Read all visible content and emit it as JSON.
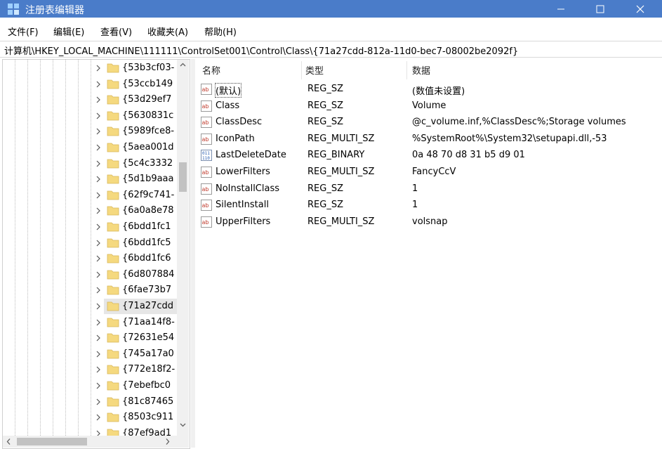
{
  "window": {
    "title": "注册表编辑器",
    "colors": {
      "titlebar": "#4a7cc9",
      "folder": "#f5d97f"
    }
  },
  "menu": [
    "文件(F)",
    "编辑(E)",
    "查看(V)",
    "收藏夹(A)",
    "帮助(H)"
  ],
  "address": "计算机\\HKEY_LOCAL_MACHINE\\111111\\ControlSet001\\Control\\Class\\{71a27cdd-812a-11d0-bec7-08002be2092f}",
  "tree": {
    "items": [
      "{53b3cf03-",
      "{53ccb149",
      "{53d29ef7",
      "{5630831c",
      "{5989fce8-",
      "{5aea001d",
      "{5c4c3332",
      "{5d1b9aaa",
      "{62f9c741-",
      "{6a0a8e78",
      "{6bdd1fc1",
      "{6bdd1fc5",
      "{6bdd1fc6",
      "{6d807884",
      "{6fae73b7",
      "{71a27cdd",
      "{71aa14f8-",
      "{72631e54",
      "{745a17a0",
      "{772e18f2-",
      "{7ebefbc0",
      "{81c87465",
      "{8503c911",
      "{87ef9ad1"
    ],
    "selected": "{71a27cdd"
  },
  "list": {
    "headers": {
      "name": "名称",
      "type": "类型",
      "data": "数据"
    },
    "rows": [
      {
        "icon": "string-value-icon",
        "name": "(默认)",
        "type": "REG_SZ",
        "data": "(数值未设置)"
      },
      {
        "icon": "string-value-icon",
        "name": "Class",
        "type": "REG_SZ",
        "data": "Volume"
      },
      {
        "icon": "string-value-icon",
        "name": "ClassDesc",
        "type": "REG_SZ",
        "data": "@c_volume.inf,%ClassDesc%;Storage volumes"
      },
      {
        "icon": "string-value-icon",
        "name": "IconPath",
        "type": "REG_MULTI_SZ",
        "data": "%SystemRoot%\\System32\\setupapi.dll,-53"
      },
      {
        "icon": "binary-value-icon",
        "name": "LastDeleteDate",
        "type": "REG_BINARY",
        "data": "0a 48 70 d8 31 b5 d9 01"
      },
      {
        "icon": "string-value-icon",
        "name": "LowerFilters",
        "type": "REG_MULTI_SZ",
        "data": "FancyCcV"
      },
      {
        "icon": "string-value-icon",
        "name": "NoInstallClass",
        "type": "REG_SZ",
        "data": "1"
      },
      {
        "icon": "string-value-icon",
        "name": "SilentInstall",
        "type": "REG_SZ",
        "data": "1"
      },
      {
        "icon": "string-value-icon",
        "name": "UpperFilters",
        "type": "REG_MULTI_SZ",
        "data": "volsnap"
      }
    ]
  }
}
